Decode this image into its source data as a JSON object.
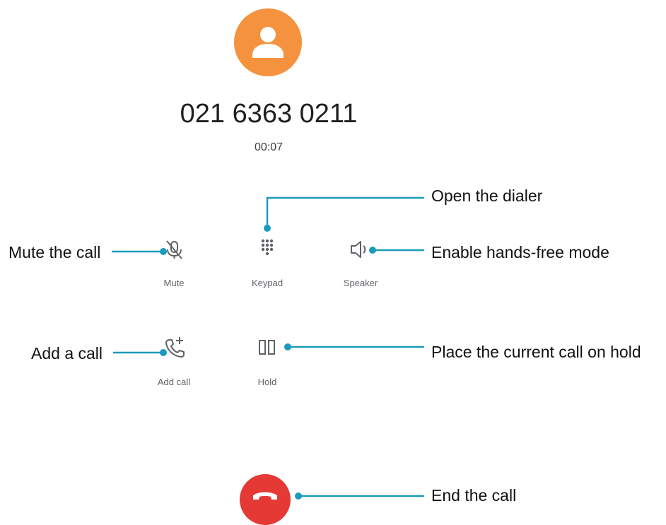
{
  "caller": {
    "avatar_icon": "person-icon",
    "avatar_color": "#f5923e",
    "number": "021 6363 0211",
    "timer": "00:07"
  },
  "controls": {
    "mute": {
      "label": "Mute",
      "icon": "mic-off-icon"
    },
    "keypad": {
      "label": "Keypad",
      "icon": "dialpad-icon"
    },
    "speaker": {
      "label": "Speaker",
      "icon": "volume-icon"
    },
    "add_call": {
      "label": "Add call",
      "icon": "add-call-icon"
    },
    "hold": {
      "label": "Hold",
      "icon": "pause-icon"
    }
  },
  "end_call": {
    "icon": "hang-up-icon",
    "color": "#e53935"
  },
  "annotations": {
    "open_dialer": "Open the dialer",
    "mute_call": "Mute the call",
    "hands_free": "Enable hands-free mode",
    "add_a_call": "Add a call",
    "hold_call": "Place the current call on hold",
    "end_the_call": "End the call"
  },
  "colors": {
    "annotation_line": "#1a9bbd",
    "icon": "#5f6368"
  }
}
